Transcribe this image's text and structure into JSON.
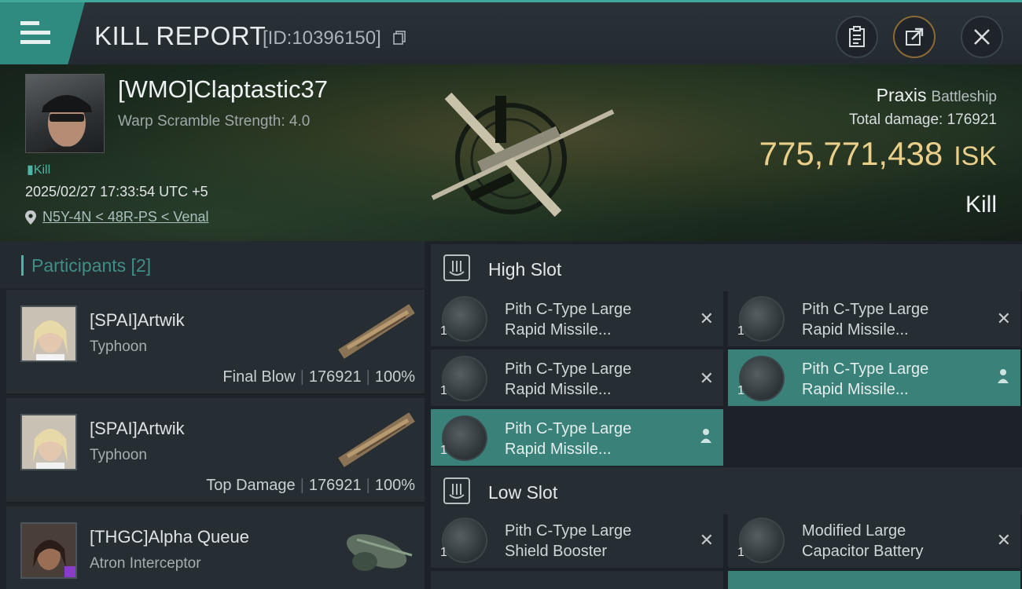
{
  "header": {
    "title": "KILL REPORT",
    "report_id": "[ID:10396150]"
  },
  "victim": {
    "name": "[WMO]Claptastic37",
    "warp_scramble": "Warp Scramble Strength: 4.0",
    "kill_tag": "Kill",
    "datetime": "2025/02/27 17:33:54 UTC +5",
    "location": "N5Y-4N < 48R-PS < Venal",
    "ship": "Praxis",
    "ship_class": "Battleship",
    "total_damage_label": "Total damage:",
    "total_damage": "176921",
    "isk_value": "775,771,438",
    "isk_unit": "ISK",
    "result": "Kill"
  },
  "participants": {
    "title": "Participants [2]",
    "rows": [
      {
        "name": "[SPAI]Artwik",
        "ship": "Typhoon",
        "role": "Final Blow",
        "damage": "176921",
        "percent": "100%"
      },
      {
        "name": "[SPAI]Artwik",
        "ship": "Typhoon",
        "role": "Top Damage",
        "damage": "176921",
        "percent": "100%"
      },
      {
        "name": "[THGC]Alpha Queue",
        "ship": "Atron Interceptor",
        "role": "",
        "damage": "",
        "percent": ""
      }
    ]
  },
  "slots": {
    "high": {
      "title": "High Slot",
      "modules": [
        {
          "line1": "Pith C-Type Large",
          "line2": "Rapid Missile...",
          "qty": "1",
          "state": "destroyed"
        },
        {
          "line1": "Pith C-Type Large",
          "line2": "Rapid Missile...",
          "qty": "1",
          "state": "destroyed"
        },
        {
          "line1": "Pith C-Type Large",
          "line2": "Rapid Missile...",
          "qty": "1",
          "state": "destroyed"
        },
        {
          "line1": "Pith C-Type Large",
          "line2": "Rapid Missile...",
          "qty": "1",
          "state": "dropped"
        },
        {
          "line1": "Pith C-Type Large",
          "line2": "Rapid Missile...",
          "qty": "1",
          "state": "dropped"
        }
      ]
    },
    "low": {
      "title": "Low Slot",
      "modules": [
        {
          "line1": "Pith C-Type Large",
          "line2": "Shield Booster",
          "qty": "1",
          "state": "destroyed"
        },
        {
          "line1": "Modified Large",
          "line2": "Capacitor Battery",
          "qty": "1",
          "state": "destroyed"
        }
      ]
    }
  },
  "icons": {
    "menu": "menu-icon",
    "clipboard": "clipboard-icon",
    "share": "share-icon",
    "close": "close-icon",
    "destroyed": "x-icon",
    "dropped": "person-icon"
  },
  "colors": {
    "accent": "#3fa89a",
    "isk": "#e9cf8a",
    "active_module": "#3a8279"
  }
}
